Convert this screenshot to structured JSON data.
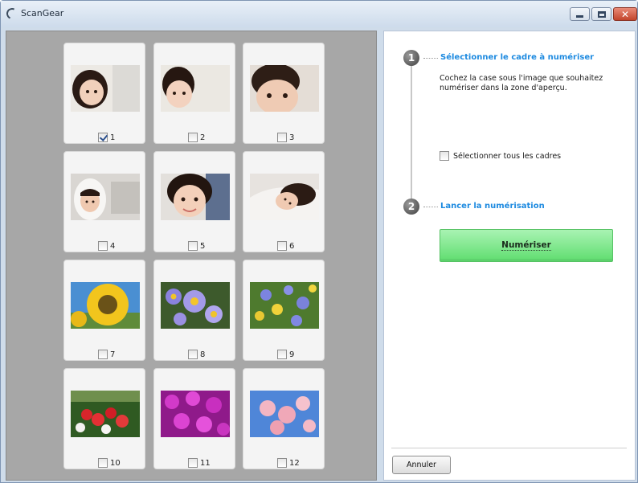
{
  "window": {
    "title": "ScanGear"
  },
  "frames": [
    {
      "number": "1",
      "checked": true,
      "photo": "child-portrait-white-hood"
    },
    {
      "number": "2",
      "checked": false,
      "photo": "child-portrait-bangs"
    },
    {
      "number": "3",
      "checked": false,
      "photo": "child-portrait-closeup"
    },
    {
      "number": "4",
      "checked": false,
      "photo": "child-in-hood"
    },
    {
      "number": "5",
      "checked": false,
      "photo": "child-smiling"
    },
    {
      "number": "6",
      "checked": false,
      "photo": "child-lying-down"
    },
    {
      "number": "7",
      "checked": false,
      "photo": "sunflower"
    },
    {
      "number": "8",
      "checked": false,
      "photo": "purple-daisies"
    },
    {
      "number": "9",
      "checked": false,
      "photo": "wildflowers"
    },
    {
      "number": "10",
      "checked": false,
      "photo": "red-berries"
    },
    {
      "number": "11",
      "checked": false,
      "photo": "magenta-flowers"
    },
    {
      "number": "12",
      "checked": false,
      "photo": "pink-blossoms"
    }
  ],
  "panel": {
    "step1": {
      "badge": "1",
      "title": "Sélectionner le cadre à numériser",
      "description": "Cochez la case sous l'image que souhaitez numériser dans la zone d'aperçu."
    },
    "select_all_label": "Sélectionner tous les cadres",
    "select_all_checked": false,
    "step2": {
      "badge": "2",
      "title": "Lancer la numérisation"
    },
    "scan_button": "Numériser",
    "cancel_button": "Annuler"
  },
  "colors": {
    "accent_title": "#1d8ae0",
    "scan_button_green": "#5fdd6f",
    "preview_background": "#a7a7a7"
  }
}
